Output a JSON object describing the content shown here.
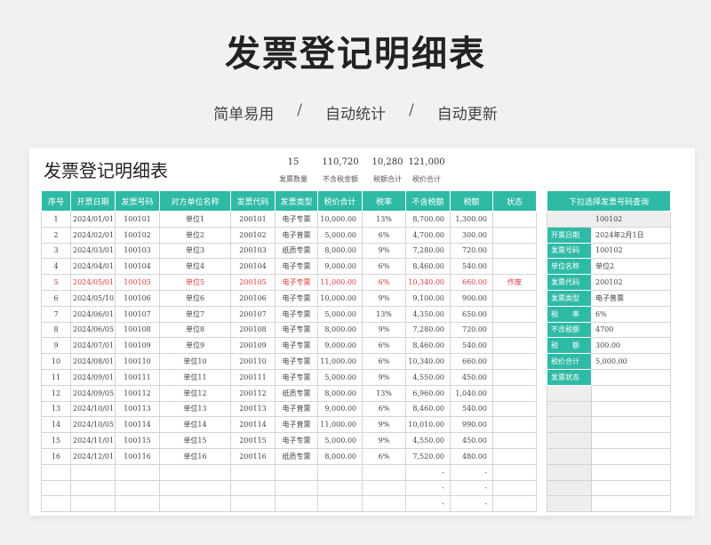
{
  "page": {
    "title": "发票登记明细表",
    "subtitle": [
      "简单易用",
      "自动统计",
      "自动更新"
    ],
    "separator": "/"
  },
  "sheet": {
    "title": "发票登记明细表",
    "summary": [
      {
        "value": "15",
        "label": "发票数量"
      },
      {
        "value": "110,720",
        "label": "不含税金额"
      },
      {
        "value": "10,280",
        "label": "税额合计"
      },
      {
        "value": "121,000",
        "label": "税价合计"
      }
    ],
    "columns": [
      "序号",
      "开票日期",
      "发票号码",
      "对方单位名称",
      "发票代码",
      "发票类型",
      "税价合计",
      "税率",
      "不含税额",
      "税额",
      "状态"
    ],
    "rows": [
      {
        "no": "1",
        "date": "2024/01/01",
        "number": "100101",
        "company": "单位1",
        "code": "200101",
        "type": "电子专票",
        "total": "10,000.00",
        "rate": "13%",
        "net": "8,700.00",
        "tax": "1,300.00",
        "status": ""
      },
      {
        "no": "2",
        "date": "2024/02/01",
        "number": "100102",
        "company": "单位2",
        "code": "200102",
        "type": "电子普票",
        "total": "5,000.00",
        "rate": "6%",
        "net": "4,700.00",
        "tax": "300.00",
        "status": ""
      },
      {
        "no": "3",
        "date": "2024/03/01",
        "number": "100103",
        "company": "单位3",
        "code": "200103",
        "type": "纸质专票",
        "total": "8,000.00",
        "rate": "9%",
        "net": "7,280.00",
        "tax": "720.00",
        "status": ""
      },
      {
        "no": "4",
        "date": "2024/04/01",
        "number": "100104",
        "company": "单位4",
        "code": "200104",
        "type": "电子专票",
        "total": "9,000.00",
        "rate": "6%",
        "net": "8,460.00",
        "tax": "540.00",
        "status": ""
      },
      {
        "no": "5",
        "date": "2024/05/01",
        "number": "100105",
        "company": "单位5",
        "code": "200105",
        "type": "电子专票",
        "total": "11,000.00",
        "rate": "6%",
        "net": "10,340.00",
        "tax": "660.00",
        "status": "作废"
      },
      {
        "no": "6",
        "date": "2024/05/10",
        "number": "100106",
        "company": "单位6",
        "code": "200106",
        "type": "电子专票",
        "total": "10,000.00",
        "rate": "9%",
        "net": "9,100.00",
        "tax": "900.00",
        "status": ""
      },
      {
        "no": "7",
        "date": "2024/06/01",
        "number": "100107",
        "company": "单位7",
        "code": "200107",
        "type": "电子专票",
        "total": "5,000.00",
        "rate": "13%",
        "net": "4,350.00",
        "tax": "650.00",
        "status": ""
      },
      {
        "no": "8",
        "date": "2024/06/05",
        "number": "100108",
        "company": "单位8",
        "code": "200108",
        "type": "电子专票",
        "total": "8,000.00",
        "rate": "9%",
        "net": "7,280.00",
        "tax": "720.00",
        "status": ""
      },
      {
        "no": "9",
        "date": "2024/07/01",
        "number": "100109",
        "company": "单位9",
        "code": "200109",
        "type": "电子专票",
        "total": "9,000.00",
        "rate": "6%",
        "net": "8,460.00",
        "tax": "540.00",
        "status": ""
      },
      {
        "no": "10",
        "date": "2024/08/01",
        "number": "100110",
        "company": "单位10",
        "code": "200110",
        "type": "电子专票",
        "total": "11,000.00",
        "rate": "6%",
        "net": "10,340.00",
        "tax": "660.00",
        "status": ""
      },
      {
        "no": "11",
        "date": "2024/09/01",
        "number": "100111",
        "company": "单位11",
        "code": "200111",
        "type": "电子专票",
        "total": "5,000.00",
        "rate": "9%",
        "net": "4,550.00",
        "tax": "450.00",
        "status": ""
      },
      {
        "no": "12",
        "date": "2024/09/05",
        "number": "100112",
        "company": "单位12",
        "code": "200112",
        "type": "纸质专票",
        "total": "8,000.00",
        "rate": "13%",
        "net": "6,960.00",
        "tax": "1,040.00",
        "status": ""
      },
      {
        "no": "13",
        "date": "2024/10/01",
        "number": "100113",
        "company": "单位13",
        "code": "200113",
        "type": "电子普票",
        "total": "9,000.00",
        "rate": "6%",
        "net": "8,460.00",
        "tax": "540.00",
        "status": ""
      },
      {
        "no": "14",
        "date": "2024/10/05",
        "number": "100114",
        "company": "单位14",
        "code": "200114",
        "type": "电子普票",
        "total": "11,000.00",
        "rate": "9%",
        "net": "10,010.00",
        "tax": "990.00",
        "status": ""
      },
      {
        "no": "15",
        "date": "2024/11/01",
        "number": "100115",
        "company": "单位15",
        "code": "200115",
        "type": "电子专票",
        "total": "5,000.00",
        "rate": "9%",
        "net": "4,550.00",
        "tax": "450.00",
        "status": ""
      },
      {
        "no": "16",
        "date": "2024/12/01",
        "number": "100116",
        "company": "单位16",
        "code": "200116",
        "type": "纸质专票",
        "total": "8,000.00",
        "rate": "6%",
        "net": "7,520.00",
        "tax": "480.00",
        "status": ""
      },
      {
        "no": "",
        "date": "",
        "number": "",
        "company": "",
        "code": "",
        "type": "",
        "total": "",
        "rate": "",
        "net": "-",
        "tax": "-",
        "status": ""
      },
      {
        "no": "",
        "date": "",
        "number": "",
        "company": "",
        "code": "",
        "type": "",
        "total": "",
        "rate": "",
        "net": "-",
        "tax": "-",
        "status": ""
      },
      {
        "no": "",
        "date": "",
        "number": "",
        "company": "",
        "code": "",
        "type": "",
        "total": "",
        "rate": "",
        "net": "-",
        "tax": "-",
        "status": ""
      }
    ],
    "highlight_row": "5",
    "highlight_color": "#e0393e",
    "accent_color": "#2fbaa5"
  },
  "lookup": {
    "header": "下拉选择发票号码查询",
    "selected": "100102",
    "fields": [
      {
        "label": "开票日期",
        "value": "2024年2月1日"
      },
      {
        "label": "发票号码",
        "value": "100102"
      },
      {
        "label": "单位名称",
        "value": "单位2"
      },
      {
        "label": "发票代码",
        "value": "200102"
      },
      {
        "label": "发票类型",
        "value": "电子普票"
      },
      {
        "label": "税　　率",
        "value": "6%"
      },
      {
        "label": "不含税额",
        "value": "4700"
      },
      {
        "label": "税　　额",
        "value": "300.00"
      },
      {
        "label": "税价合计",
        "value": "5,000.00"
      },
      {
        "label": "发票状态",
        "value": ""
      }
    ]
  }
}
